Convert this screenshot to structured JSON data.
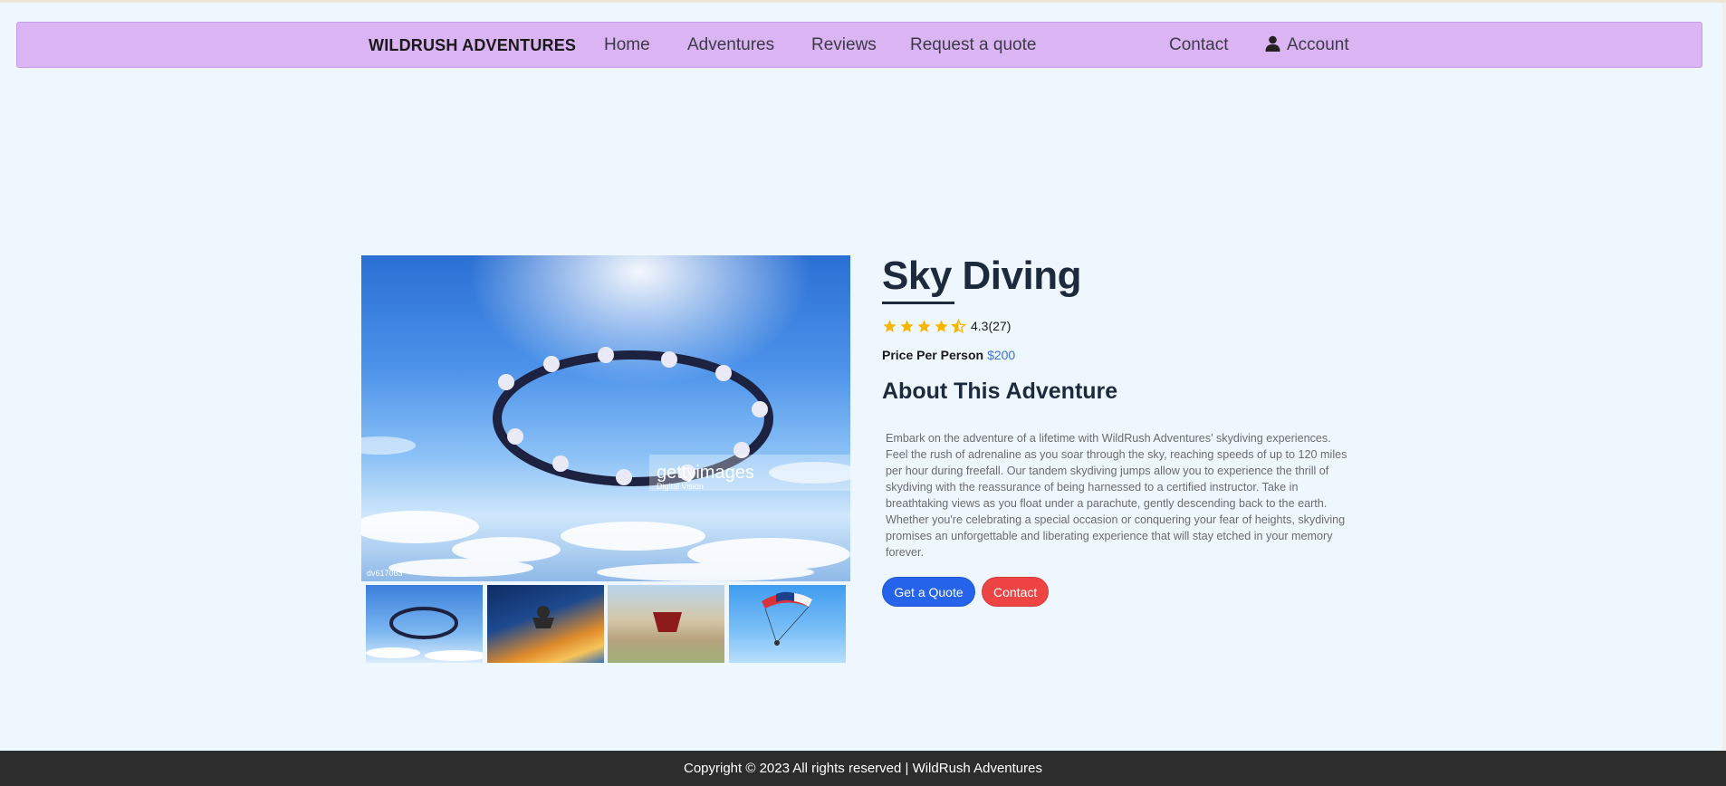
{
  "nav": {
    "brand": "WILDRUSH ADVENTURES",
    "items": [
      "Home",
      "Adventures",
      "Reviews",
      "Request a quote"
    ],
    "contact": "Contact",
    "account": "Account",
    "account_icon": "user-icon"
  },
  "product": {
    "title": "Sky Diving",
    "rating": 4.3,
    "rating_text": "4.3(27)",
    "price_label": "Price Per Person",
    "price": "$200",
    "about_heading": "About This Adventure",
    "description": "Embark on the adventure of a lifetime with WildRush Adventures' skydiving experiences. Feel the rush of adrenaline as you soar through the sky, reaching speeds of up to 120 miles per hour during freefall. Our tandem skydiving jumps allow you to experience the thrill of skydiving with the reassurance of being harnessed to a certified instructor. Take in breathtaking views as you float under a parachute, gently descending back to the earth. Whether you're celebrating a special occasion or conquering your fear of heights, skydiving promises an unforgettable and liberating experience that will stay etched in your memory forever.",
    "buttons": {
      "quote": "Get a Quote",
      "contact": "Contact"
    }
  },
  "gallery": {
    "main_watermark": "gettyimages",
    "main_watermark_sub": "Digital Vision",
    "main_image_code": "dv617063",
    "thumbnails": [
      "formation-skydivers",
      "sunset-tandem-jump",
      "freefall-over-fields",
      "parachute-descent"
    ]
  },
  "footer": {
    "text": "Copyright © 2023 All rights reserved | WildRush Adventures"
  },
  "colors": {
    "navbar": "#dbb4f4",
    "background": "#eef7fe",
    "primary_button": "#2563eb",
    "danger_button": "#ef4444",
    "star": "#f7b500",
    "price": "#3d6fe0"
  }
}
